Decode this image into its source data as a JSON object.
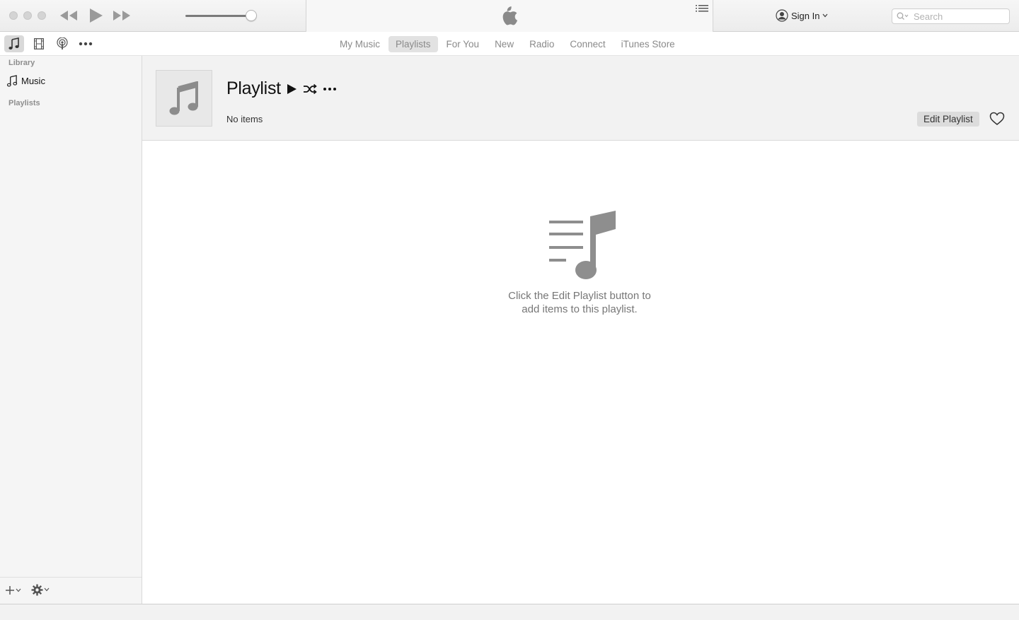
{
  "search": {
    "placeholder": "Search"
  },
  "account": {
    "sign_in_label": "Sign In"
  },
  "nav": {
    "tabs": [
      {
        "label": "My Music"
      },
      {
        "label": "Playlists",
        "active": true
      },
      {
        "label": "For You"
      },
      {
        "label": "New"
      },
      {
        "label": "Radio"
      },
      {
        "label": "Connect"
      },
      {
        "label": "iTunes Store"
      }
    ]
  },
  "sidebar": {
    "library_label": "Library",
    "items": [
      {
        "label": "Music",
        "icon": "music-note-icon"
      }
    ],
    "playlists_label": "Playlists"
  },
  "playlist": {
    "title": "Playlist",
    "count": "No items",
    "edit_label": "Edit Playlist"
  },
  "empty_state": {
    "line1": "Click the Edit Playlist button to",
    "line2": "add items to this playlist."
  },
  "volume": {
    "level": 0.94
  },
  "colors": {
    "icon_gray": "#8c8c8c",
    "active_tab_bg": "#e2e2e2",
    "sidebar_bg": "#f5f5f5"
  }
}
